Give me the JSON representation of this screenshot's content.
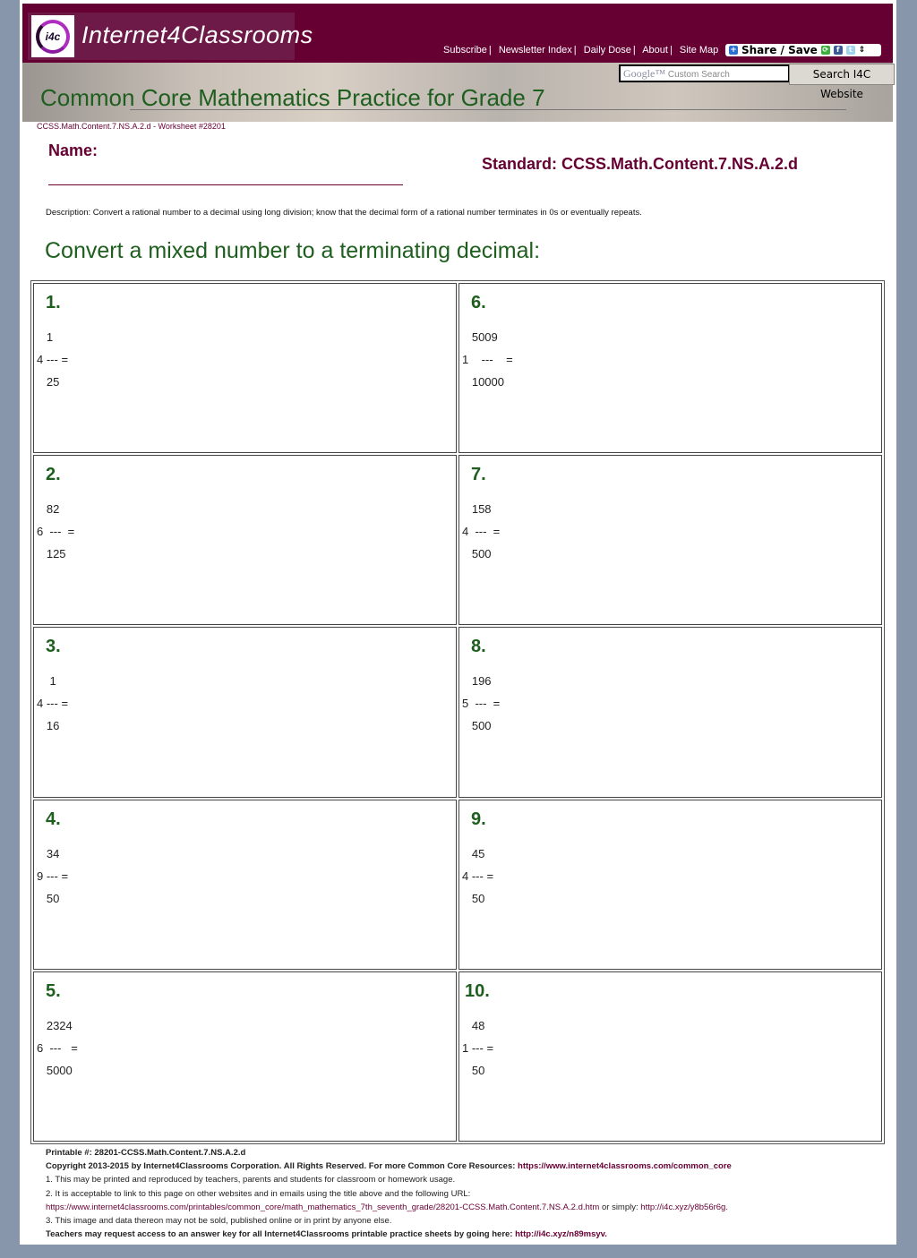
{
  "header": {
    "logo_badge": "i4c",
    "logo_text": "Internet4Classrooms",
    "nav": [
      "Subscribe",
      "Newsletter Index",
      "Daily Dose",
      "About",
      "Site Map"
    ],
    "share_label": "Share / Save",
    "search_placeholder_brand": "Google™",
    "search_placeholder": "Custom Search",
    "search_button": "Search I4C Website"
  },
  "page": {
    "title": "Common Core Mathematics Practice for Grade 7",
    "worksheet_id": "CCSS.Math.Content.7.NS.A.2.d - Worksheet #28201",
    "name_label": "Name:",
    "standard": "Standard: CCSS.Math.Content.7.NS.A.2.d",
    "description": "Description: Convert a rational number to a decimal using long division; know that the decimal form of a rational number terminates in 0s or eventually repeats.",
    "instructions": "Convert a mixed number to a terminating decimal:"
  },
  "problems": [
    {
      "num": "1.",
      "whole": "4",
      "numerator": "1",
      "denominator": "25"
    },
    {
      "num": "6.",
      "whole": "1",
      "numerator": "5009",
      "denominator": "10000"
    },
    {
      "num": "2.",
      "whole": "6",
      "numerator": "82",
      "denominator": "125"
    },
    {
      "num": "7.",
      "whole": "4",
      "numerator": "158",
      "denominator": "500"
    },
    {
      "num": "3.",
      "whole": "4",
      "numerator": "1",
      "denominator": "16"
    },
    {
      "num": "8.",
      "whole": "5",
      "numerator": "196",
      "denominator": "500"
    },
    {
      "num": "4.",
      "whole": "9",
      "numerator": "34",
      "denominator": "50"
    },
    {
      "num": "9.",
      "whole": "4",
      "numerator": "45",
      "denominator": "50"
    },
    {
      "num": "5.",
      "whole": "6",
      "numerator": "2324",
      "denominator": "5000"
    },
    {
      "num": "10.",
      "whole": "1",
      "numerator": "48",
      "denominator": "50"
    }
  ],
  "footer": {
    "printable": "Printable #: 28201-CCSS.Math.Content.7.NS.A.2.d",
    "copyright": "Copyright 2013-2015 by Internet4Classrooms Corporation. All Rights Reserved. For more Common Core Resources: ",
    "copyright_link": "https://www.internet4classrooms.com/common_core",
    "line1": "1. This may be printed and reproduced by teachers, parents and students for classroom or homework usage.",
    "line2": "2. It is acceptable to link to this page on other websites and in emails using the title above and the following URL:",
    "url_long": "https://www.internet4classrooms.com/printables/common_core/math_mathematics_7th_seventh_grade/28201-CCSS.Math.Content.7.NS.A.2.d.htm",
    "or_simply": " or simply: ",
    "url_short": "http://i4c.xyz/y8b56r6g.",
    "line3": "3. This image and data thereon may not be sold, published online or in print by anyone else.",
    "answer_key": "Teachers may request access to an answer key for all Internet4Classrooms printable practice sheets by going here: ",
    "answer_key_link": "http://i4c.xyz/n89msyv."
  }
}
